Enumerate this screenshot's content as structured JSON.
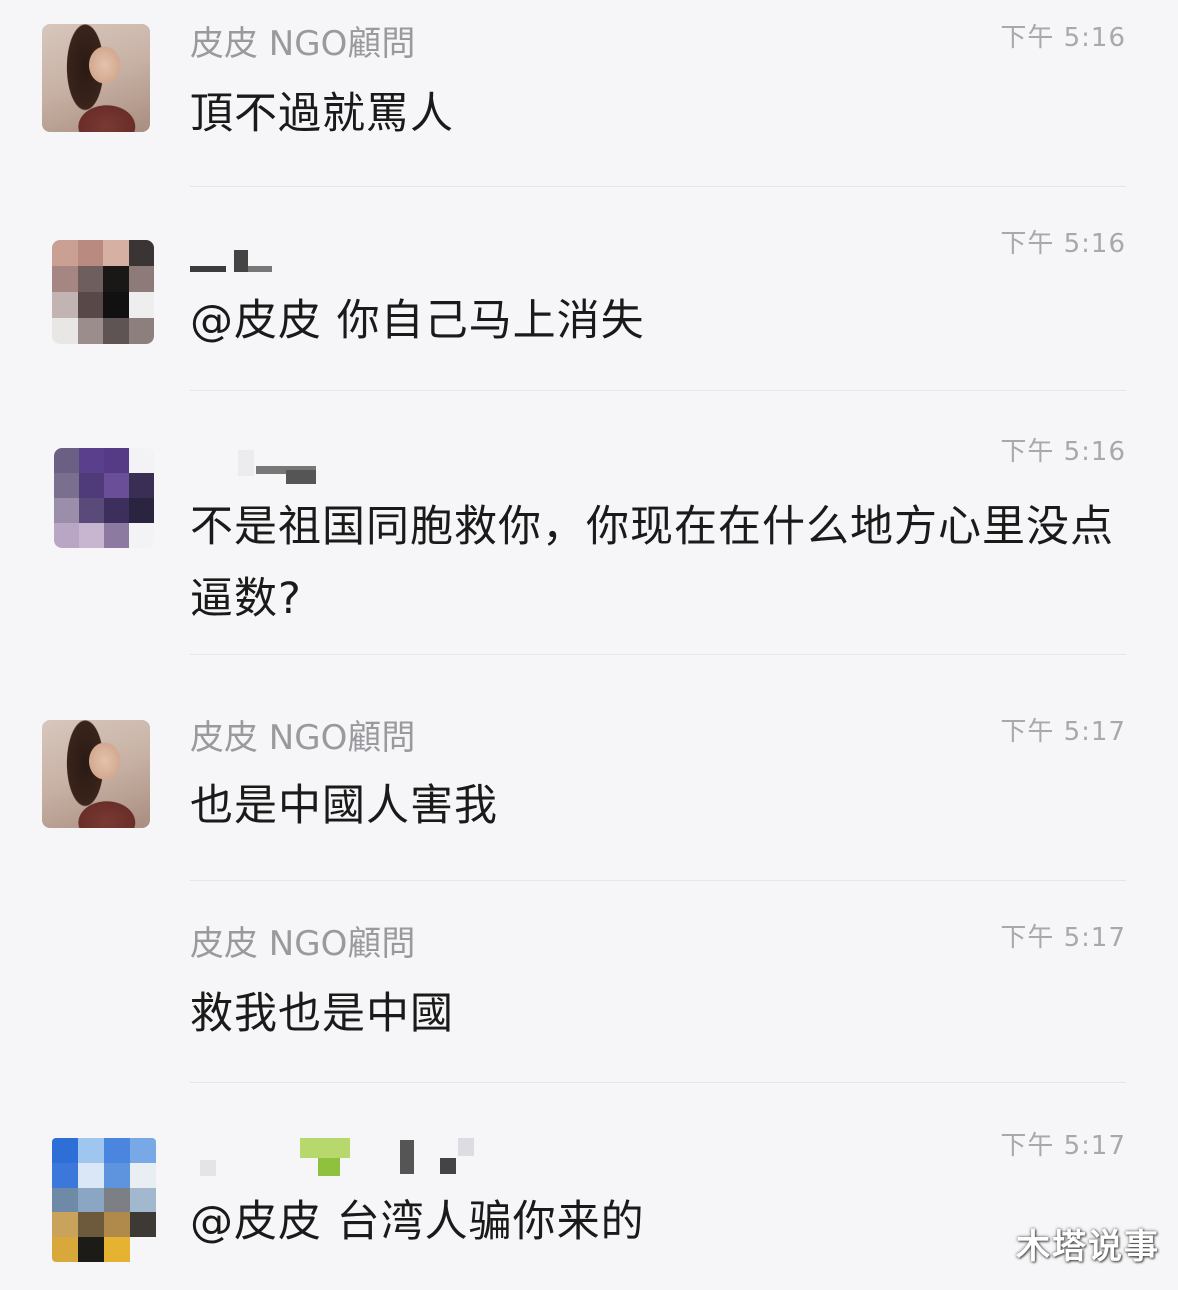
{
  "messages": [
    {
      "sender": "皮皮 NGO顧問",
      "time": "下午 5:16",
      "text": "頂不過就罵人"
    },
    {
      "sender": "",
      "time": "下午 5:16",
      "text": "@皮皮 你自己马上消失"
    },
    {
      "sender": "",
      "time": "下午 5:16",
      "text": "不是祖国同胞救你，你现在在什么地方心里没点逼数?"
    },
    {
      "sender": "皮皮 NGO顧問",
      "time": "下午 5:17",
      "text": "也是中國人害我"
    },
    {
      "sender": "皮皮 NGO顧問",
      "time": "下午 5:17",
      "text": "救我也是中國"
    },
    {
      "sender": "",
      "time": "下午 5:17",
      "text": "@皮皮 台湾人骗你来的"
    }
  ],
  "watermark": "木塔说事",
  "colors": {
    "background": "#f6f6f8",
    "name": "#9a9a9e",
    "time": "#a8a8ad",
    "text": "#1a1a1a"
  }
}
